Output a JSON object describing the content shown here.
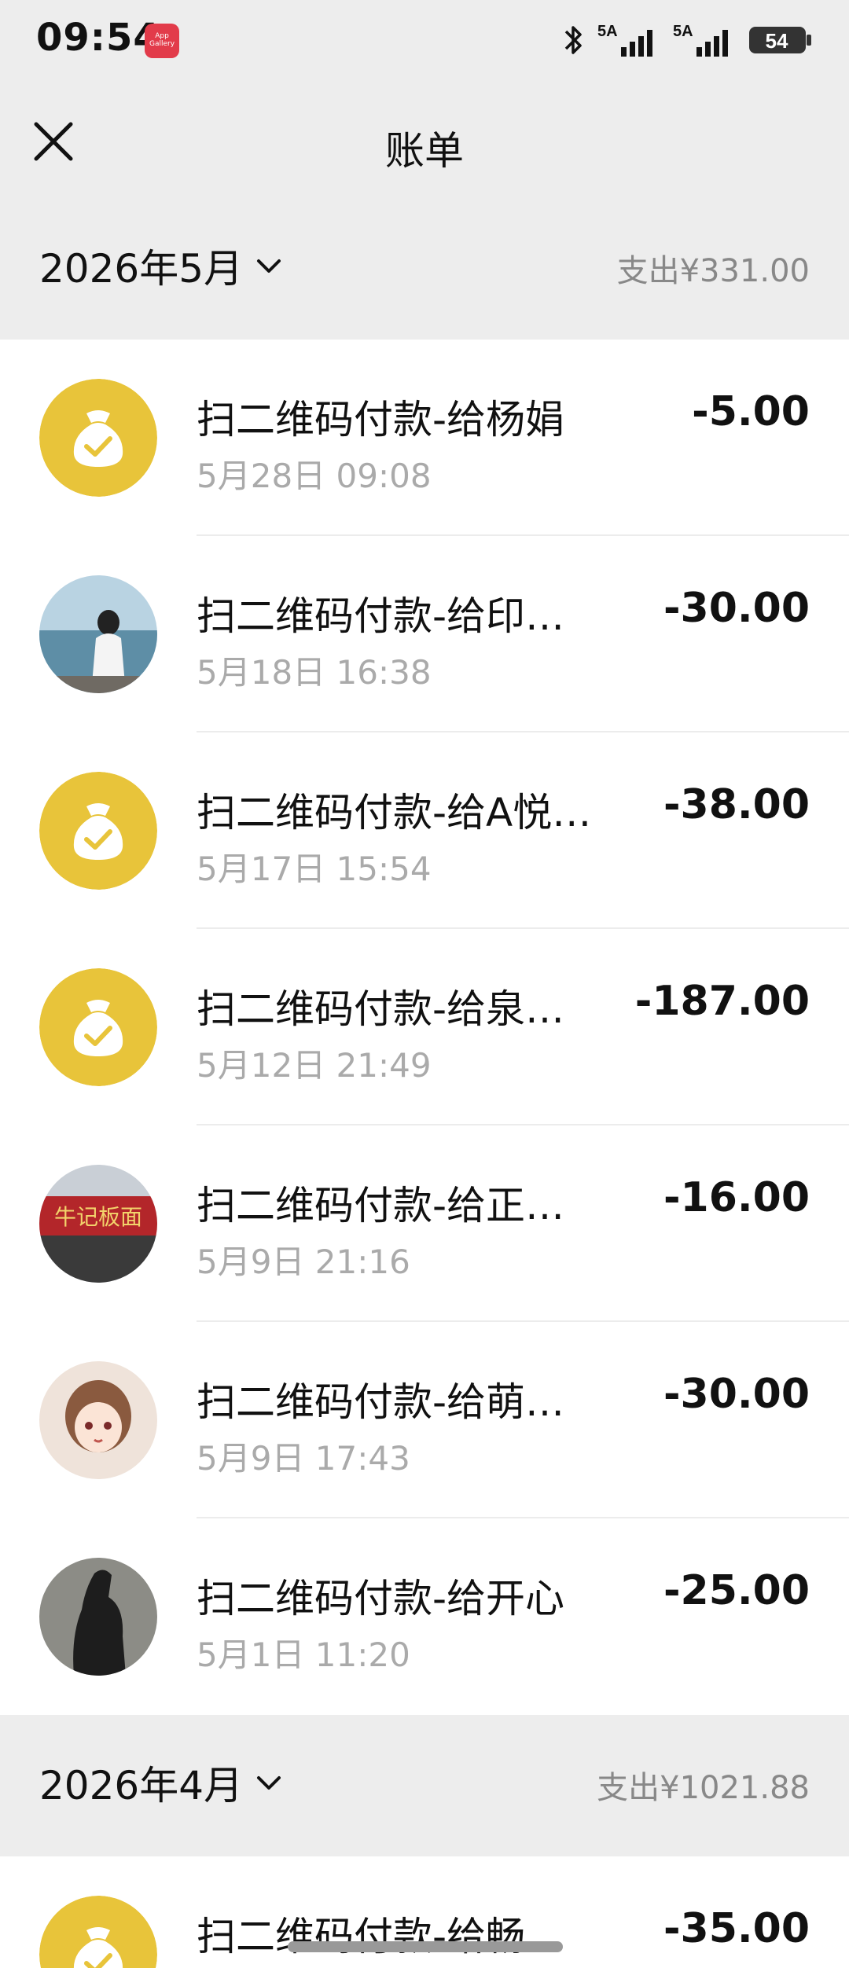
{
  "status_bar": {
    "time": "09:54",
    "app_icon_text": "App Gallery",
    "signal_1": "5A",
    "signal_2": "5A",
    "battery": "54"
  },
  "nav": {
    "title": "账单"
  },
  "months": [
    {
      "label": "2026年5月",
      "total": "支出¥331.00"
    },
    {
      "label": "2026年4月",
      "total": "支出¥1021.88"
    }
  ],
  "may_items": [
    {
      "title": "扫二维码付款-给杨娟",
      "time": "5月28日 09:08",
      "amount": "-5.00",
      "avatar": "moneybag-icon"
    },
    {
      "title": "扫二维码付款-给印…",
      "time": "5月18日 16:38",
      "amount": "-30.00",
      "avatar": "photo-avatar"
    },
    {
      "title": "扫二维码付款-给A悦…",
      "time": "5月17日 15:54",
      "amount": "-38.00",
      "avatar": "moneybag-icon"
    },
    {
      "title": "扫二维码付款-给泉…",
      "time": "5月12日 21:49",
      "amount": "-187.00",
      "avatar": "moneybag-icon"
    },
    {
      "title": "扫二维码付款-给正…",
      "time": "5月9日 21:16",
      "amount": "-16.00",
      "avatar": "photo-avatar"
    },
    {
      "title": "扫二维码付款-给萌…",
      "time": "5月9日 17:43",
      "amount": "-30.00",
      "avatar": "photo-avatar"
    },
    {
      "title": "扫二维码付款-给开心",
      "time": "5月1日 11:20",
      "amount": "-25.00",
      "avatar": "photo-avatar"
    }
  ],
  "april_items": [
    {
      "title": "扫二维码付款-给畅…",
      "amount": "-35.00",
      "avatar": "moneybag-icon"
    }
  ],
  "colors": {
    "background": "#ededed",
    "moneybag": "#e8c43a",
    "secondary_text": "#aaaaaa"
  }
}
